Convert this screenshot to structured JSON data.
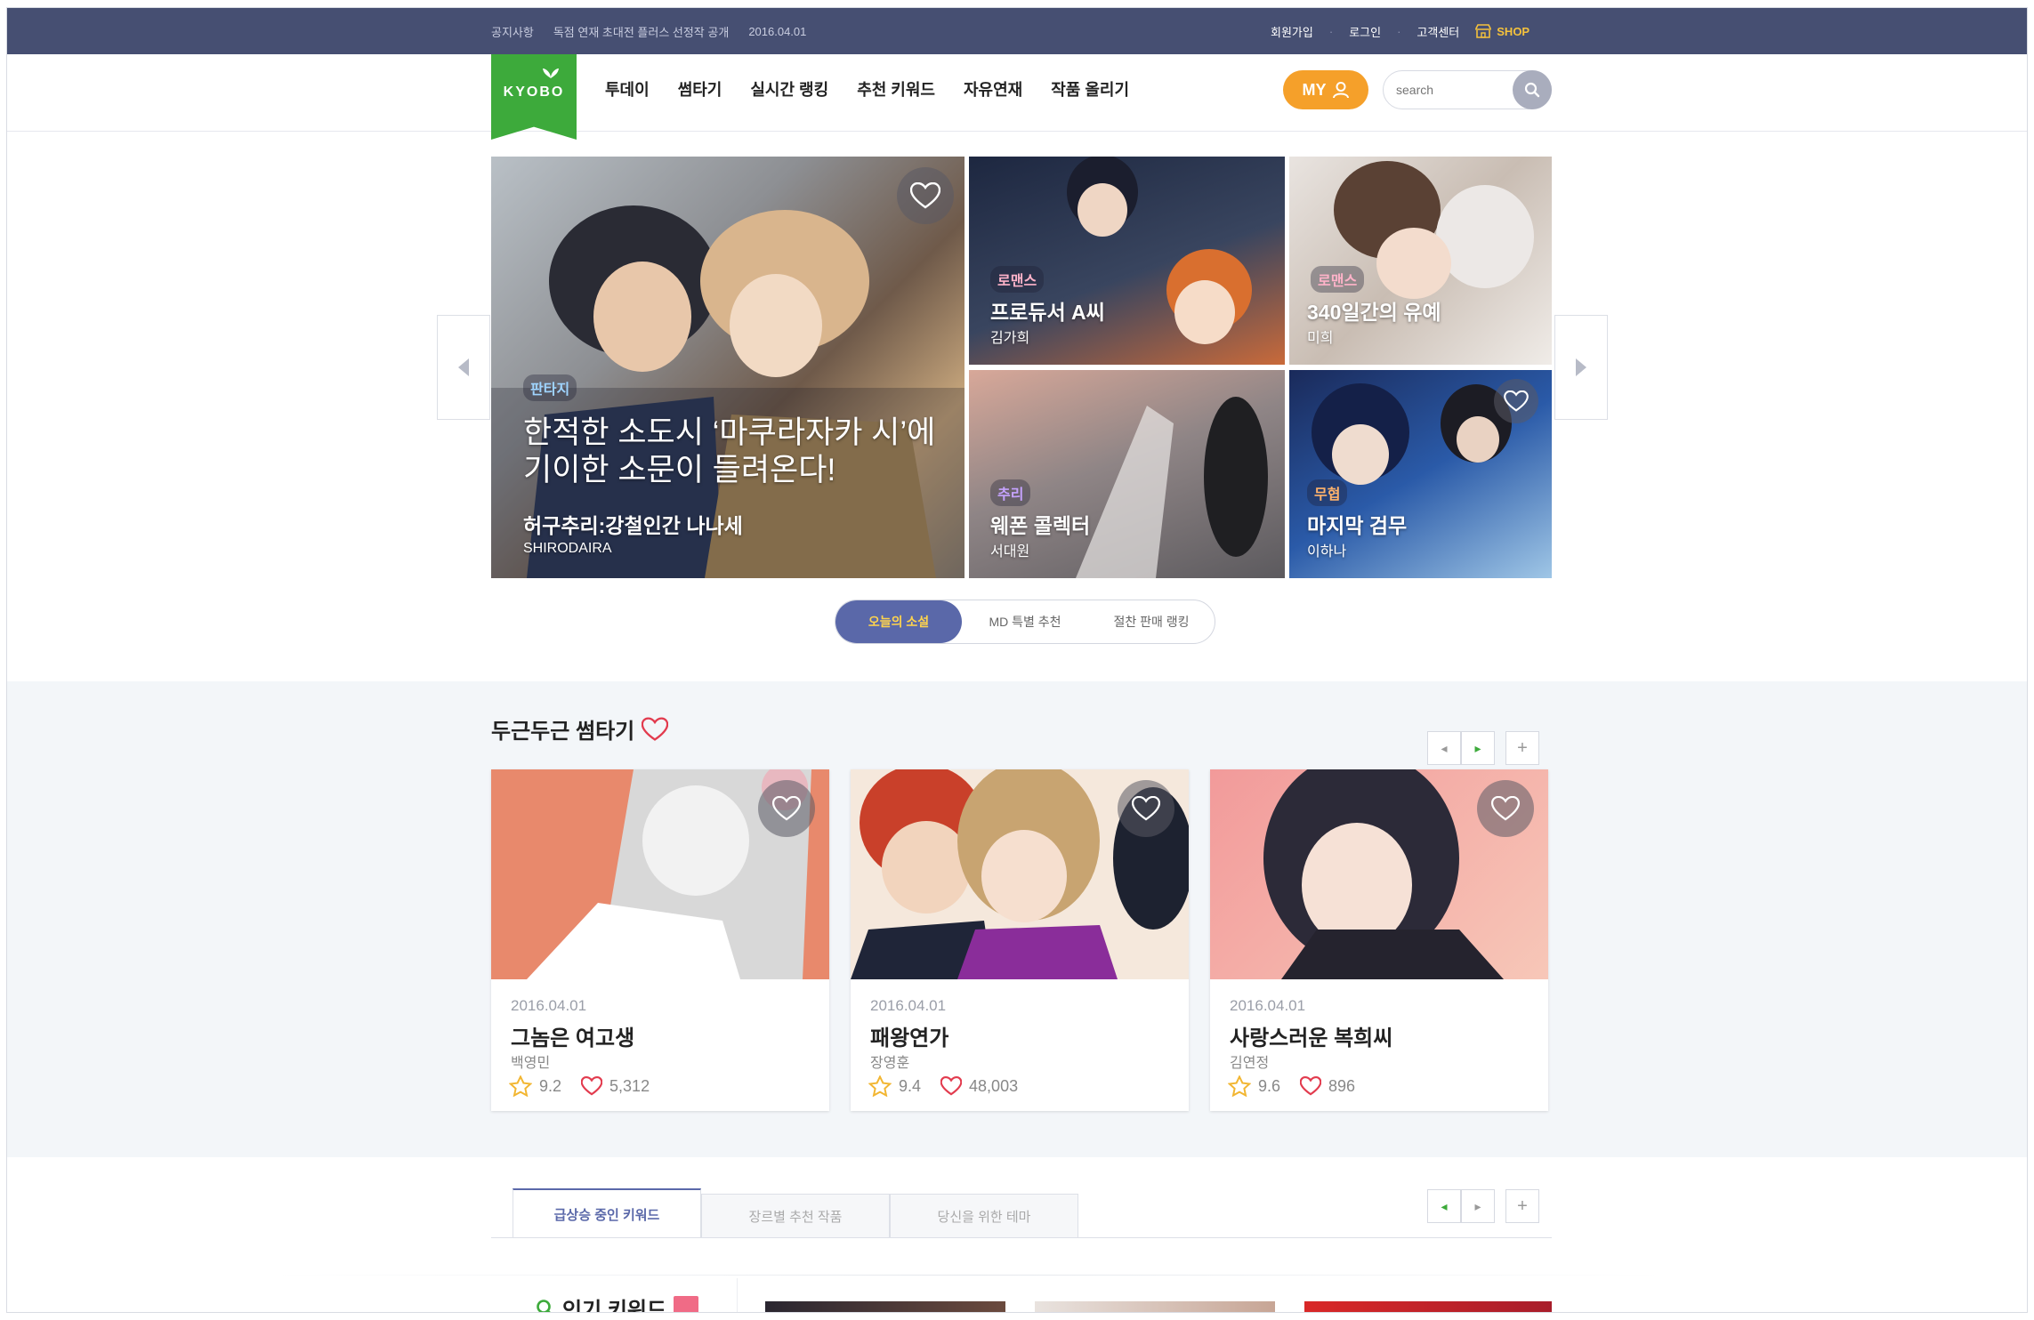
{
  "topbar": {
    "notice_label": "공지사항",
    "notice_text": "독점 연재 초대전 플러스 선정작 공개",
    "notice_date": "2016.04.01",
    "links": [
      "회원가입",
      "로그인",
      "고객센터"
    ],
    "shop": "SHOP"
  },
  "header": {
    "logo": "KYOBO",
    "menu": [
      "투데이",
      "썸타기",
      "실시간 랭킹",
      "추천 키워드",
      "자유연재",
      "작품 올리기"
    ],
    "my_label": "MY",
    "search_placeholder": "search"
  },
  "hero": {
    "main": {
      "category": "판타지",
      "headline_1": "한적한 소도시 ‘마쿠라자카 시’에",
      "headline_2": "기이한 소문이 들려온다!",
      "title": "허구추리:강철인간 나나세",
      "author": "SHIRODAIRA"
    },
    "tiles": [
      {
        "category": "로맨스",
        "title": "프로듀서 A씨",
        "author": "김가희"
      },
      {
        "category": "로맨스",
        "title": "340일간의 유예",
        "author": "미희"
      },
      {
        "category": "추리",
        "title": "웨폰 콜렉터",
        "author": "서대원"
      },
      {
        "category": "무협",
        "title": "마지막 검무",
        "author": "이하나"
      }
    ]
  },
  "hero_tabs": [
    "오늘의 소설",
    "MD 특별 추천",
    "절찬 판매 랭킹"
  ],
  "section_thumb": {
    "title": "두근두근 썸타기",
    "cards": [
      {
        "date": "2016.04.01",
        "title": "그놈은 여고생",
        "author": "백영민",
        "rating": "9.2",
        "likes": "5,312"
      },
      {
        "date": "2016.04.01",
        "title": "패왕연가",
        "author": "장영훈",
        "rating": "9.4",
        "likes": "48,003"
      },
      {
        "date": "2016.04.01",
        "title": "사랑스러운 복희씨",
        "author": "김연정",
        "rating": "9.6",
        "likes": "896"
      }
    ]
  },
  "keyword_tabs": [
    "급상승 중인 키워드",
    "장르별 추천 작품",
    "당신을 위한 테마"
  ],
  "popular_keyword": "인기 키워드",
  "colors": {
    "topbar": "#464f72",
    "accent": "#5a68a9",
    "brand_green": "#3daa3b",
    "my_orange": "#f5a02a",
    "heart_red": "#e23b4e",
    "star_yellow": "#f2b632"
  }
}
